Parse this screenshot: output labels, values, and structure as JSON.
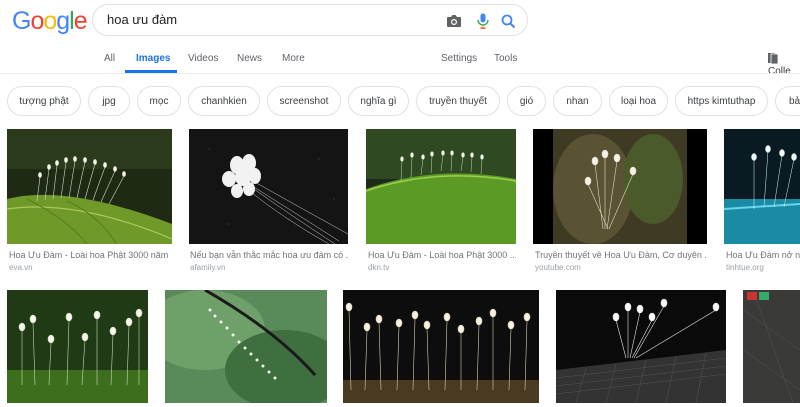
{
  "logo": {
    "letters": [
      "G",
      "o",
      "o",
      "g",
      "l",
      "e"
    ],
    "colors": [
      "#4285f4",
      "#ea4335",
      "#fbbc05",
      "#4285f4",
      "#34a853",
      "#ea4335"
    ]
  },
  "search": {
    "query": "hoa ưu đàm"
  },
  "nav": {
    "tabs": [
      "All",
      "Images",
      "Videos",
      "News",
      "More"
    ],
    "settings": "Settings",
    "tools": "Tools",
    "collections": "Colle"
  },
  "chips": [
    "tượng phật",
    "jpg",
    "mọc",
    "chanhkien",
    "screenshot",
    "nghĩa gì",
    "truyền thuyết",
    "gió",
    "nhan",
    "loại hoa",
    "https kimtuthap",
    "bả"
  ],
  "results_row1": [
    {
      "title": "Hoa Ưu Đàm - Loài hoa Phật 3000 năm ...",
      "source": "eva.vn"
    },
    {
      "title": "Nếu bạn vẫn thắc mắc hoa ưu đàm có ...",
      "source": "afamily.vn"
    },
    {
      "title": "Hoa Ưu Đàm - Loài hoa Phật 3000 ...",
      "source": "dkn.tv"
    },
    {
      "title": "Truyền thuyết về Hoa Ưu Đàm, Cơ duyên ...",
      "source": "youtube.com"
    },
    {
      "title": "Hoa Ưu Đàm nở nh",
      "source": "tinhtue.org"
    }
  ],
  "colors": {
    "accent": "#1a73e8",
    "chip_border": "#dfe1e5"
  }
}
